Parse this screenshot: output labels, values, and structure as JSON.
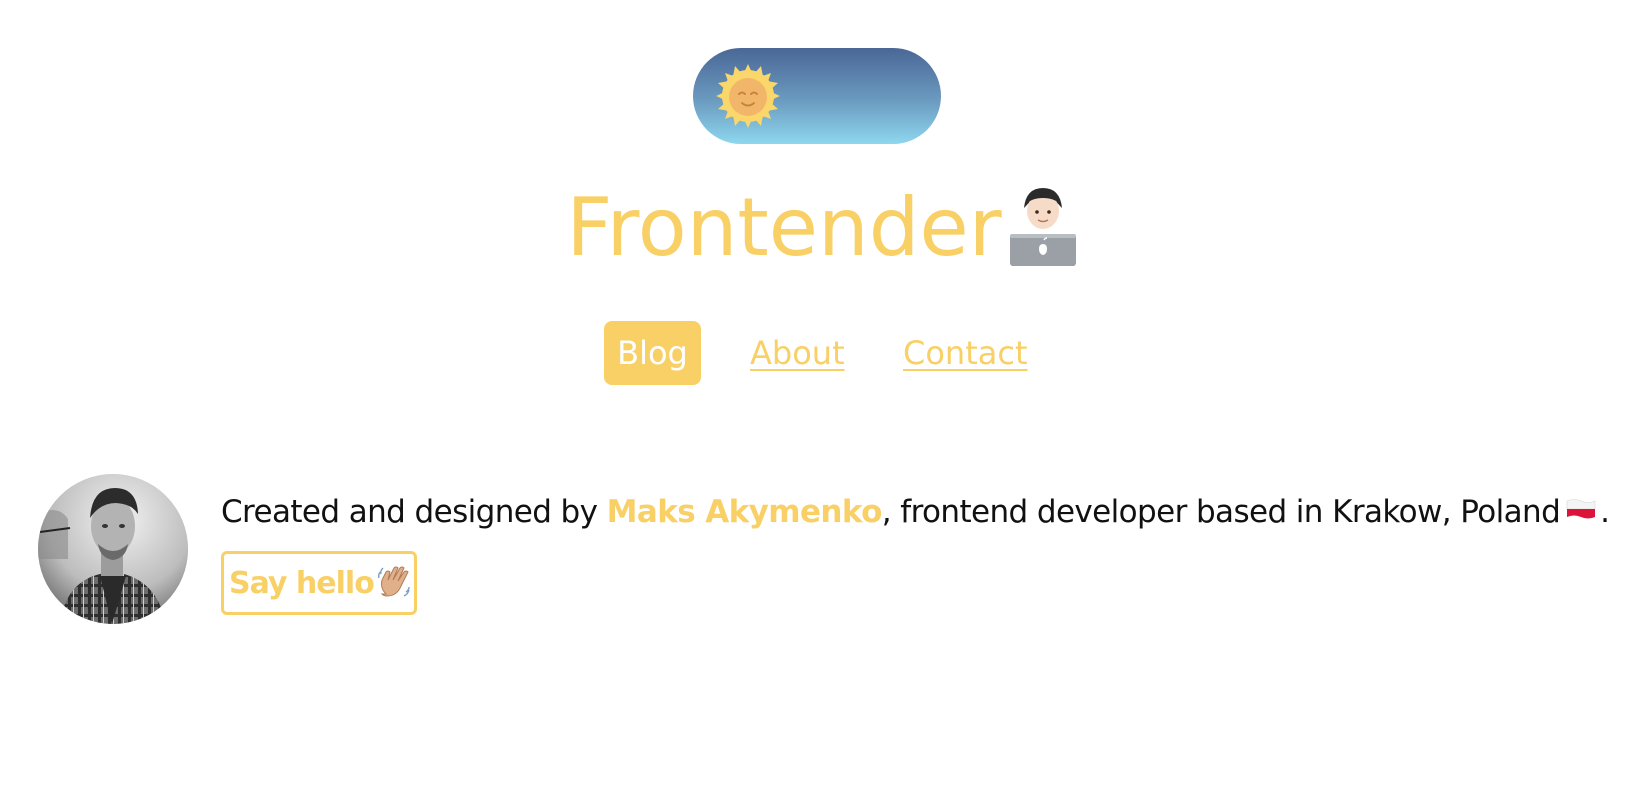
{
  "theme_toggle": {
    "state_icon": "sun-face-icon",
    "colors": {
      "gradient_top": "#4a6796",
      "gradient_bottom": "#8ed7ee",
      "sun": "#fbd66a"
    }
  },
  "header": {
    "title": "Frontender",
    "title_icon": "technologist-laptop-icon"
  },
  "nav": {
    "items": [
      {
        "label": "Blog",
        "active": true
      },
      {
        "label": "About",
        "active": false
      },
      {
        "label": "Contact",
        "active": false
      }
    ]
  },
  "bio": {
    "prefix": "Created and designed by ",
    "author": "Maks Akymenko",
    "suffix": ", frontend developer based in Krakow, Poland",
    "flag_icon": "poland-flag-icon",
    "end": ".",
    "avatar_icon": "author-avatar",
    "button_label": "Say hello",
    "button_icon": "waving-hand-icon"
  },
  "colors": {
    "accent": "#f8d066",
    "text": "#111111",
    "background": "#ffffff"
  }
}
